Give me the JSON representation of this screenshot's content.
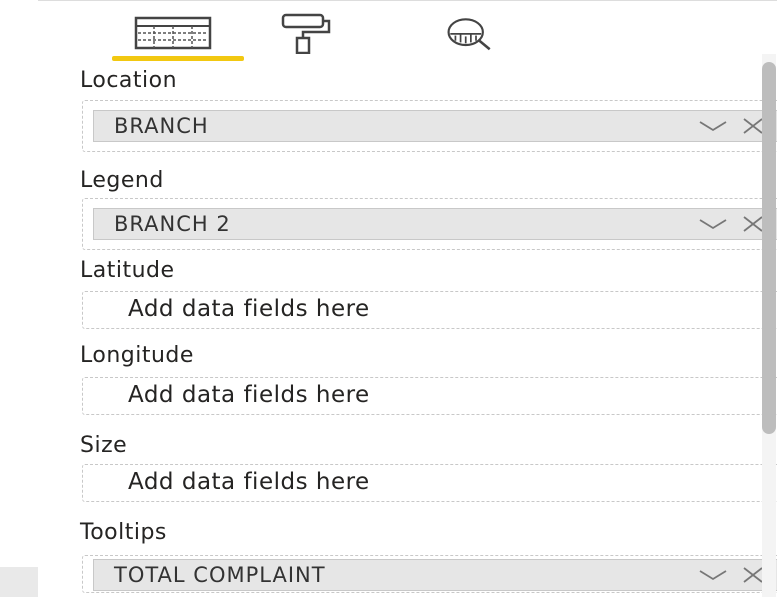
{
  "tabs": [
    {
      "name": "fields",
      "icon": "fields-grid-icon",
      "active": true
    },
    {
      "name": "format",
      "icon": "paint-roller-icon",
      "active": false
    },
    {
      "name": "analytics",
      "icon": "magnifier-analytics-icon",
      "active": false
    }
  ],
  "accent_color": "#f2c811",
  "wells": {
    "location": {
      "label": "Location",
      "field": "BRANCH"
    },
    "legend": {
      "label": "Legend",
      "field": "BRANCH 2"
    },
    "latitude": {
      "label": "Latitude",
      "placeholder": "Add data fields here"
    },
    "longitude": {
      "label": "Longitude",
      "placeholder": "Add data fields here"
    },
    "size": {
      "label": "Size",
      "placeholder": "Add data fields here"
    },
    "tooltips": {
      "label": "Tooltips",
      "field": "TOTAL COMPLAINT"
    }
  }
}
